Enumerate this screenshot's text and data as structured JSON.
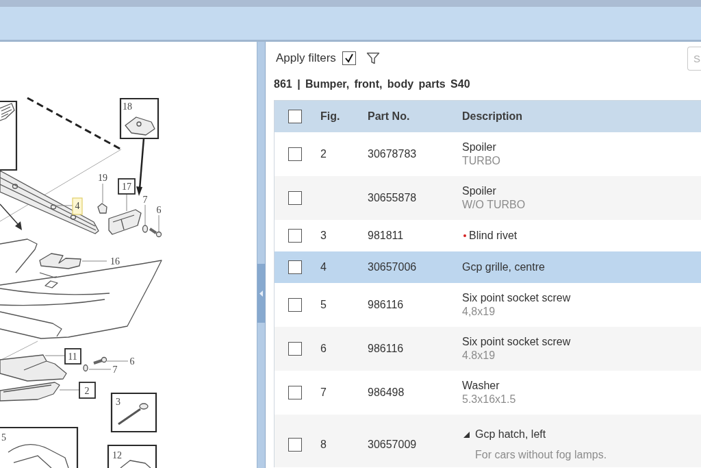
{
  "filters": {
    "label": "Apply filters",
    "checked": true
  },
  "search": {
    "placeholder": "S"
  },
  "heading": "861 | Bumper, front, body parts S40",
  "diagram": {
    "callouts": [
      {
        "label": "18",
        "kind": "inset",
        "selected": false
      },
      {
        "label": "19",
        "kind": "plain",
        "selected": false
      },
      {
        "label": "17",
        "kind": "boxed",
        "selected": false
      },
      {
        "label": "7",
        "kind": "plain",
        "selected": false
      },
      {
        "label": "6",
        "kind": "plain",
        "selected": false
      },
      {
        "label": "4",
        "kind": "plain",
        "selected": true
      },
      {
        "label": "16",
        "kind": "plain",
        "selected": false
      },
      {
        "label": "11",
        "kind": "boxed",
        "selected": false
      },
      {
        "label": "6",
        "kind": "plain",
        "selected": false
      },
      {
        "label": "7",
        "kind": "plain",
        "selected": false
      },
      {
        "label": "2",
        "kind": "boxed",
        "selected": false
      },
      {
        "label": "3",
        "kind": "inset",
        "selected": false
      },
      {
        "label": "5",
        "kind": "inset",
        "selected": false
      },
      {
        "label": "12",
        "kind": "inset",
        "selected": false
      }
    ]
  },
  "table": {
    "all_checked": false,
    "columns": [
      "Fig.",
      "Part No.",
      "Description"
    ],
    "rows": [
      {
        "kind": "part",
        "fig": "2",
        "part_no": "30678783",
        "description": "Spoiler",
        "note": "TURBO",
        "checked": false,
        "selected": false,
        "flagged": false
      },
      {
        "kind": "part",
        "part_no": "30655878",
        "description": "Spoiler",
        "note": "W/O TURBO",
        "checked": false,
        "selected": false,
        "flagged": false
      },
      {
        "kind": "part",
        "fig": "3",
        "part_no": "981811",
        "description": "Blind rivet",
        "checked": false,
        "selected": false,
        "flagged": true
      },
      {
        "kind": "part",
        "fig": "4",
        "part_no": "30657006",
        "description": "Gcp grille, centre",
        "checked": false,
        "selected": true,
        "flagged": false
      },
      {
        "kind": "part",
        "fig": "5",
        "part_no": "986116",
        "description": "Six point socket screw",
        "note": "4,8x19",
        "checked": false,
        "selected": false,
        "flagged": false
      },
      {
        "kind": "part",
        "fig": "6",
        "part_no": "986116",
        "description": "Six point socket screw",
        "note": "4.8x19",
        "checked": false,
        "selected": false,
        "flagged": false
      },
      {
        "kind": "part",
        "fig": "7",
        "part_no": "986498",
        "description": "Washer",
        "note": "5.3x16x1.5",
        "checked": false,
        "selected": false,
        "flagged": false
      },
      {
        "kind": "group",
        "fig": "8",
        "part_no": "30657009",
        "description": "Gcp hatch, left",
        "note": "For cars without fog lamps.",
        "checked": false,
        "selected": false,
        "flagged": false,
        "expanded": true
      }
    ]
  }
}
